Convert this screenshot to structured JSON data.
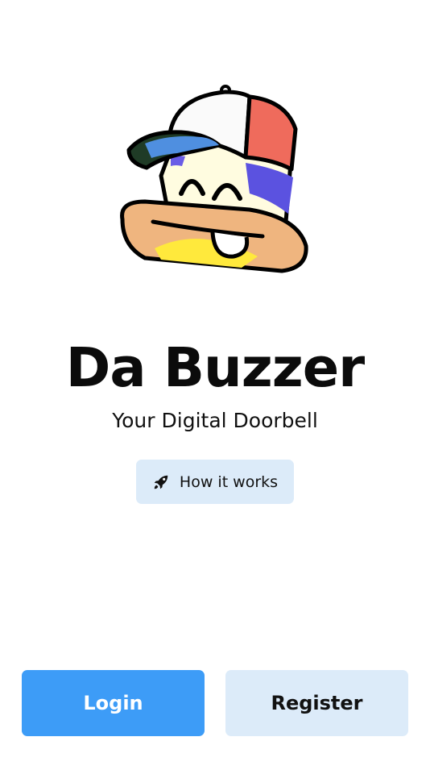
{
  "app": {
    "title": "Da Buzzer",
    "subtitle": "Your Digital Doorbell"
  },
  "how_it_works": {
    "label": "How it works",
    "icon": "rocket-icon"
  },
  "actions": {
    "login_label": "Login",
    "register_label": "Register"
  },
  "colors": {
    "primary": "#3d9cf7",
    "secondary": "#dcebf9",
    "text": "#111111",
    "background": "#ffffff"
  },
  "mascot": {
    "name": "mascot-illustration"
  }
}
